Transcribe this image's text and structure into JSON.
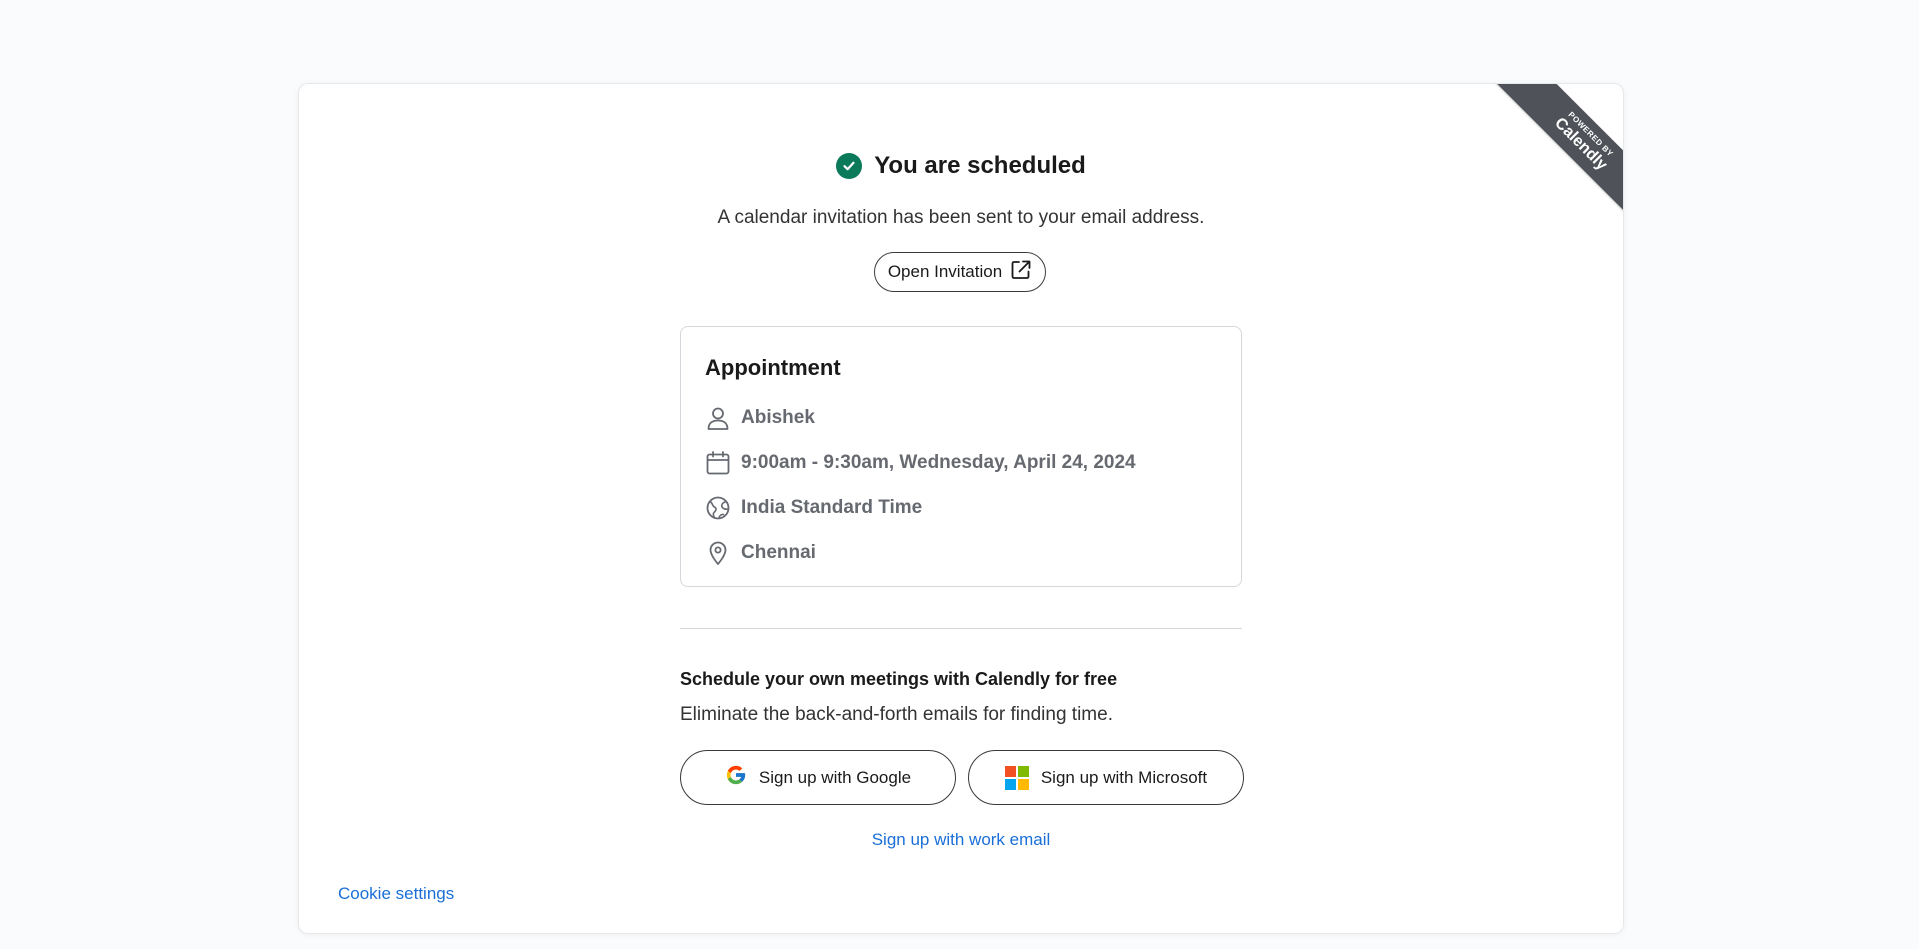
{
  "ribbon": {
    "powered_by": "POWERED BY",
    "brand": "Calendly",
    "color": "#4f5359"
  },
  "header": {
    "title": "You are scheduled",
    "subtitle": "A calendar invitation has been sent to your email address.",
    "check_icon": "check-circle-icon",
    "check_color": "#0b7a5b"
  },
  "open_invitation": {
    "label": "Open Invitation",
    "icon": "external-link-icon"
  },
  "event": {
    "name": "Appointment",
    "details": [
      {
        "icon": "person-icon",
        "text": "Abishek"
      },
      {
        "icon": "calendar-icon",
        "text": "9:00am - 9:30am, Wednesday, April 24, 2024"
      },
      {
        "icon": "globe-icon",
        "text": "India Standard Time"
      },
      {
        "icon": "location-pin-icon",
        "text": "Chennai"
      }
    ]
  },
  "promo": {
    "title": "Schedule your own meetings with Calendly for free",
    "subtitle": "Eliminate the back-and-forth emails for finding time.",
    "google_label": "Sign up with Google",
    "microsoft_label": "Sign up with Microsoft",
    "work_email_label": "Sign up with work email"
  },
  "footer": {
    "cookie_label": "Cookie settings"
  },
  "colors": {
    "link": "#1a6fd8",
    "detail_text": "#666a70"
  }
}
